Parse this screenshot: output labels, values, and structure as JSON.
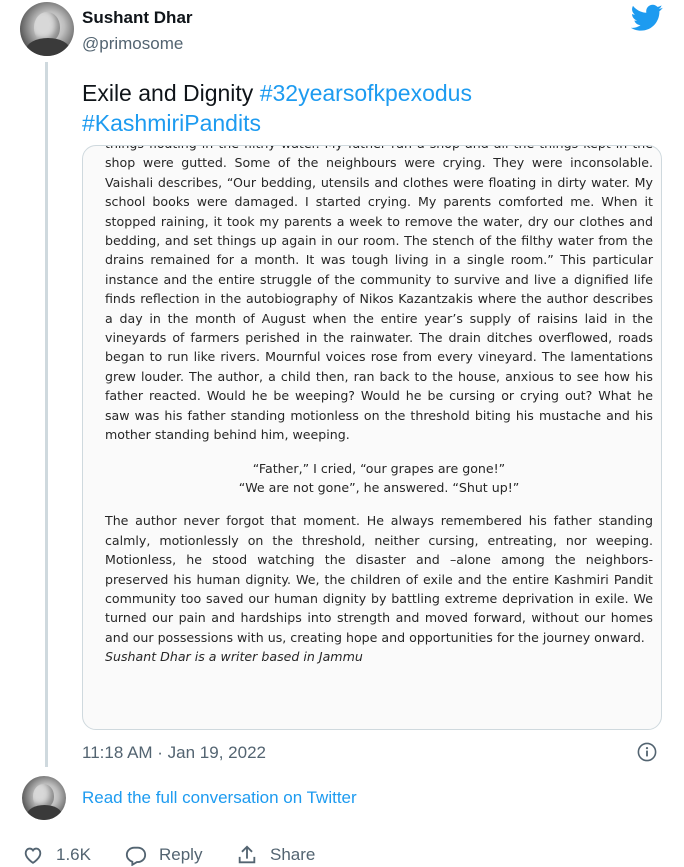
{
  "author": {
    "name": "Sushant Dhar",
    "handle": "@primosome"
  },
  "tweet": {
    "text_plain": "Exile and Dignity ",
    "hashtag1": "#32yearsofkpexodus",
    "hashtag2": "#KashmiriPandits"
  },
  "article": {
    "para1": "things floating in the filthy water. My father ran a shop and all the things kept in the shop were gutted. Some of the neighbours were crying. They were inconsolable. Vaishali describes, “Our bedding, utensils and clothes were floating in dirty water. My school books were damaged. I started crying. My parents comforted me. When it stopped raining, it took my parents a week to remove the water, dry our clothes and bedding, and set things up again in our room. The stench of the filthy water from the drains remained for a month. It was tough living in a single room.” This particular instance and the entire struggle of the community to survive and live a dignified life finds reflection in the autobiography of Nikos Kazantzakis where the author describes a day in the month of August when the entire year’s supply of raisins laid in the vineyards of farmers perished in the rainwater. The drain ditches overflowed, roads began to run like rivers. Mournful voices rose from every vineyard. The lamentations grew louder. The author, a child then, ran back to the house, anxious to see how his father reacted. Would he be weeping? Would he be cursing or crying out? What he saw was his father standing motionless on the threshold biting his mustache and his mother standing behind him, weeping.",
    "quote1": "“Father,” I cried, “our grapes are gone!”",
    "quote2": "“We are not gone”, he answered. “Shut up!”",
    "para2": "The author never forgot that moment. He always remembered his father standing calmly, motionlessly on the threshold, neither cursing, entreating, nor weeping. Motionless, he stood watching the disaster and –alone among the neighbors-preserved his human dignity. We, the children of exile and the entire Kashmiri Pandit community too saved our human dignity by battling extreme deprivation in exile. We turned our pain and hardships into strength and moved forward, without our homes and our possessions with us, creating hope and opportunities for the journey onward.",
    "byline": "Sushant Dhar is a writer based in Jammu"
  },
  "meta": {
    "timestamp": "11:18 AM · Jan 19, 2022",
    "read_link": "Read the full conversation on Twitter"
  },
  "actions": {
    "like_count": "1.6K",
    "reply_label": "Reply",
    "share_label": "Share"
  },
  "icons": {
    "brand": "twitter-bird-icon",
    "info": "info-icon",
    "like": "heart-icon",
    "reply": "speech-bubble-icon",
    "share": "share-upload-icon"
  },
  "colors": {
    "accent": "#1d9bf0",
    "text": "#0f1419",
    "muted": "#536471",
    "border": "#cfd9de"
  }
}
